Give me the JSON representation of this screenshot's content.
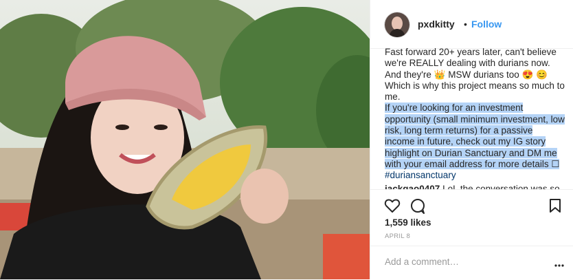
{
  "post": {
    "username": "pxdkitty",
    "separator": "•",
    "follow_label": "Follow",
    "caption_lines": [
      "Fast forward 20+ years later, can't believe we're REALLY dealing with durians now. And they're",
      "MSW durians too",
      "Which is why this project means so much to me."
    ],
    "caption_highlight": "If you're looking for an investment opportunity (small minimum investment, low risk, long term returns) for a passive income in future, check out my IG story highlight on Durian Sanctuary and DM me with your email address for more details",
    "hashtag": "#duriansanctuary",
    "emoji_crown": "👑",
    "emoji_heart_eyes": "😍",
    "emoji_blush": "😊",
    "emoji_box": "☐",
    "comment_username": "jackgao0407",
    "comment_text": "LoL the conversation was so",
    "likes": "1,559 likes",
    "date": "APRIL 8",
    "add_comment_placeholder": "Add a comment…",
    "more_icon": "more-dots-icon"
  },
  "colors": {
    "link_blue": "#3897f0",
    "selection": "#b4d3f6",
    "hashtag": "#003569"
  }
}
